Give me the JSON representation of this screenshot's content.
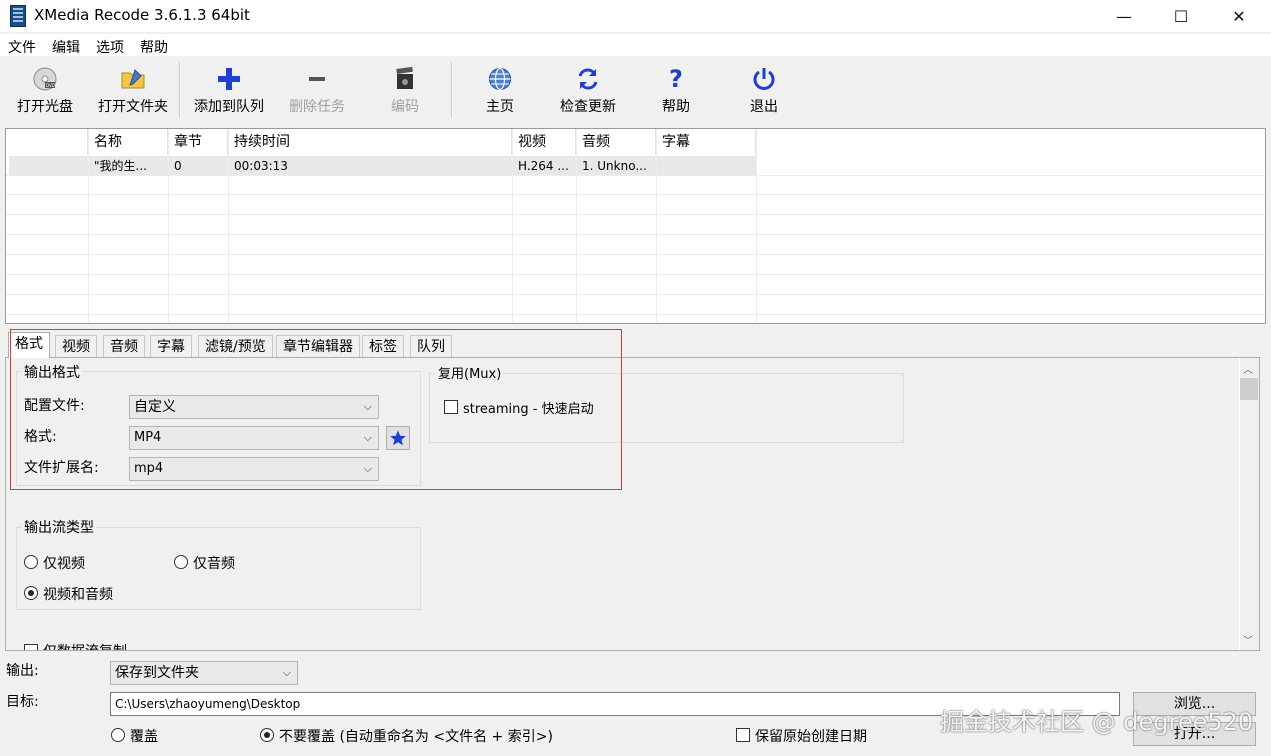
{
  "window": {
    "title": "XMedia Recode 3.6.1.3 64bit",
    "minimize": "—",
    "maximize": "☐",
    "close": "✕"
  },
  "menu": [
    "文件",
    "编辑",
    "选项",
    "帮助"
  ],
  "toolbar": {
    "open_disc": "打开光盘",
    "open_folder": "打开文件夹",
    "add_to_queue": "添加到队列",
    "delete_task": "删除任务",
    "encode": "编码",
    "home": "主页",
    "check_update": "检查更新",
    "help": "帮助",
    "exit": "退出"
  },
  "table": {
    "columns": [
      "",
      "名称",
      "章节",
      "持续时间",
      "视频",
      "音频",
      "字幕"
    ],
    "rows": [
      [
        "",
        "\"我的生...",
        "0",
        "00:03:13",
        "H.264 ...",
        "1. Unkno...",
        ""
      ]
    ]
  },
  "tabs": [
    "格式",
    "视频",
    "音频",
    "字幕",
    "滤镜/预览",
    "章节编辑器",
    "标签",
    "队列"
  ],
  "format_tab": {
    "output_format_group": "输出格式",
    "profile_label": "配置文件:",
    "profile_value": "自定义",
    "format_label": "格式:",
    "format_value": "MP4",
    "ext_label": "文件扩展名:",
    "ext_value": "mp4",
    "mux_group": "复用(Mux)",
    "streaming_label": "streaming - 快速启动",
    "stream_type_group": "输出流类型",
    "video_only": "仅视频",
    "audio_only": "仅音频",
    "video_and_audio": "视频和音频",
    "partial_label": "仅数据流复制"
  },
  "bottom": {
    "output_label": "输出:",
    "output_value": "保存到文件夹",
    "target_label": "目标:",
    "target_value": "C:\\Users\\zhaoyumeng\\Desktop",
    "browse": "浏览...",
    "open": "打开...",
    "overwrite": "覆盖",
    "no_overwrite": "不要覆盖 (自动重命名为 <文件名 + 索引>)",
    "keep_date": "保留原始创建日期"
  },
  "watermark": "掘金技术社区 @ degree520",
  "colors": {
    "accent_blue": "#1f3fd4",
    "highlight_red": "#e53935"
  }
}
